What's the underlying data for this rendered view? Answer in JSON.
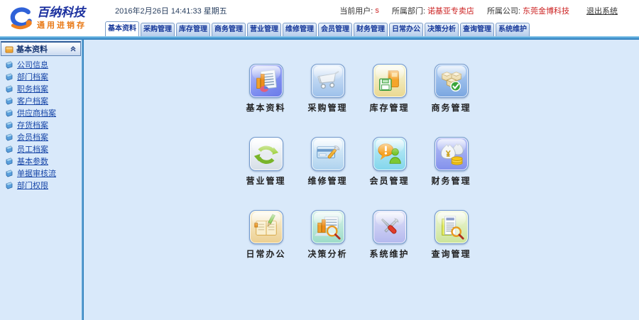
{
  "brand": {
    "company": "百纳科技",
    "product": "通用进销存"
  },
  "header": {
    "datetime": "2016年2月26日 14:41:33 星期五",
    "current_user_label": "当前用户:",
    "current_user": "s",
    "department_label": "所属部门:",
    "department": "诺基亚专卖店",
    "company_label": "所属公司:",
    "company": "东莞金博科技",
    "logout_label": "退出系统"
  },
  "tabs": [
    {
      "label": "基本资料",
      "active": true
    },
    {
      "label": "采购管理",
      "active": false
    },
    {
      "label": "库存管理",
      "active": false
    },
    {
      "label": "商务管理",
      "active": false
    },
    {
      "label": "营业管理",
      "active": false
    },
    {
      "label": "维修管理",
      "active": false
    },
    {
      "label": "会员管理",
      "active": false
    },
    {
      "label": "财务管理",
      "active": false
    },
    {
      "label": "日常办公",
      "active": false
    },
    {
      "label": "决策分析",
      "active": false
    },
    {
      "label": "查询管理",
      "active": false
    },
    {
      "label": "系统维护",
      "active": false
    }
  ],
  "sidebar": {
    "title": "基本资料",
    "items": [
      "公司信息",
      "部门档案",
      "职务档案",
      "客户档案",
      "供应商档案",
      "存货档案",
      "会员档案",
      "员工档案",
      "基本参数",
      "单据审核流",
      "部门权限"
    ]
  },
  "modules": [
    {
      "label": "基本资料",
      "icon": "chart-icon"
    },
    {
      "label": "采购管理",
      "icon": "shopping-cart-icon"
    },
    {
      "label": "库存管理",
      "icon": "book-floppy-icon"
    },
    {
      "label": "商务管理",
      "icon": "cubes-check-icon"
    },
    {
      "label": "营业管理",
      "icon": "recycle-arrows-icon"
    },
    {
      "label": "维修管理",
      "icon": "card-wrench-icon"
    },
    {
      "label": "会员管理",
      "icon": "bubble-person-icon"
    },
    {
      "label": "财务管理",
      "icon": "moneybag-coins-icon"
    },
    {
      "label": "日常办公",
      "icon": "planner-pencil-icon"
    },
    {
      "label": "决策分析",
      "icon": "chart-magnifier-icon"
    },
    {
      "label": "系统维护",
      "icon": "tools-icon"
    },
    {
      "label": "查询管理",
      "icon": "document-magnifier-icon"
    }
  ],
  "colors": {
    "accent_red": "#cc2222",
    "brand_blue": "#1a2f9e",
    "brand_orange": "#e87a18",
    "bar_blue": "#2e7ab8",
    "tab_text": "#16389a",
    "sidebar_link": "#1847a8"
  }
}
